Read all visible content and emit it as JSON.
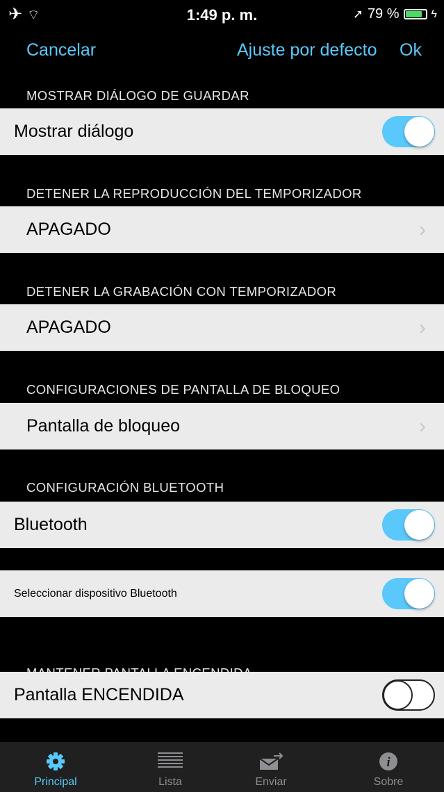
{
  "status_bar": {
    "time": "1:49 p. m.",
    "battery": "79 %",
    "battery_level": 0.79
  },
  "nav": {
    "cancel": "Cancelar",
    "default": "Ajuste por defecto",
    "ok": "Ok"
  },
  "colors": {
    "accent": "#5ac8fa",
    "row_bg": "#ebebeb",
    "background": "#000000",
    "tabbar_bg": "#202020"
  },
  "sections": {
    "save_dialog": {
      "header": "MOSTRAR DIÁLOGO DE GUARDAR",
      "label": "Mostrar diálogo",
      "toggle": "on"
    },
    "playback_timer": {
      "header": "DETENER LA REPRODUCCIÓN DEL TEMPORIZADOR",
      "label": "APAGADO"
    },
    "record_timer": {
      "header": "DETENER LA GRABACIÓN CON TEMPORIZADOR",
      "label": "APAGADO"
    },
    "lock_screen": {
      "header": "CONFIGURACIONES DE PANTALLA DE BLOQUEO",
      "label": "Pantalla de bloqueo"
    },
    "bluetooth": {
      "header": "CONFIGURACIÓN BLUETOOTH",
      "label": "Bluetooth",
      "toggle": "on"
    },
    "bluetooth_device": {
      "label": "Seleccionar dispositivo Bluetooth",
      "toggle": "on"
    },
    "screen_on": {
      "header": "MANTENER PANTALLA ENCENDIDA",
      "label": "Pantalla ENCENDIDA",
      "toggle": "off"
    }
  },
  "chevron": "›",
  "tabs": [
    {
      "label": "Principal",
      "icon": "gear-icon",
      "active": true
    },
    {
      "label": "Lista",
      "icon": "list-icon",
      "active": false
    },
    {
      "label": "Enviar",
      "icon": "send-envelope-icon",
      "active": false
    },
    {
      "label": "Sobre",
      "icon": "info-icon",
      "active": false
    }
  ]
}
